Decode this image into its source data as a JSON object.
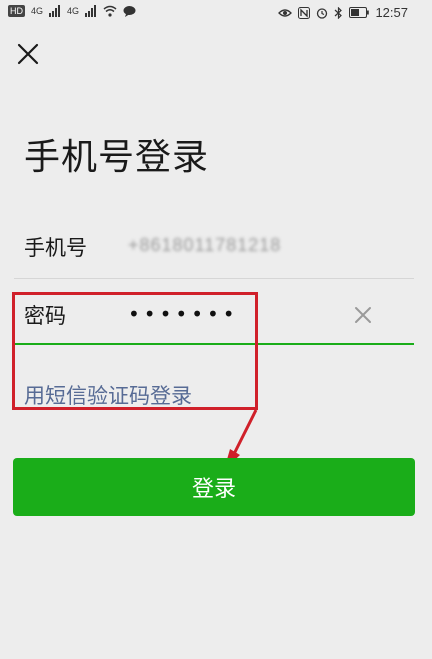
{
  "status_bar": {
    "left_badges": [
      "HD",
      "4G",
      "4G"
    ],
    "icons": [
      "signal-icon",
      "wifi-icon",
      "message-icon",
      "eye-icon",
      "nfc-icon",
      "alarm-icon",
      "bluetooth-icon",
      "battery-icon"
    ],
    "time": "12:57"
  },
  "header": {
    "close_icon": "close-icon",
    "title": "手机号登录"
  },
  "form": {
    "phone": {
      "label": "手机号",
      "value": "+8618011781218"
    },
    "password": {
      "label": "密码",
      "value": "•••••••",
      "clear_icon": "clear-icon"
    },
    "sms_login_link": "用短信验证码登录",
    "submit_label": "登录"
  },
  "colors": {
    "background": "#ededed",
    "primary_green": "#1aad19",
    "link_blue": "#576b95",
    "annotation_red": "#d0202a"
  }
}
